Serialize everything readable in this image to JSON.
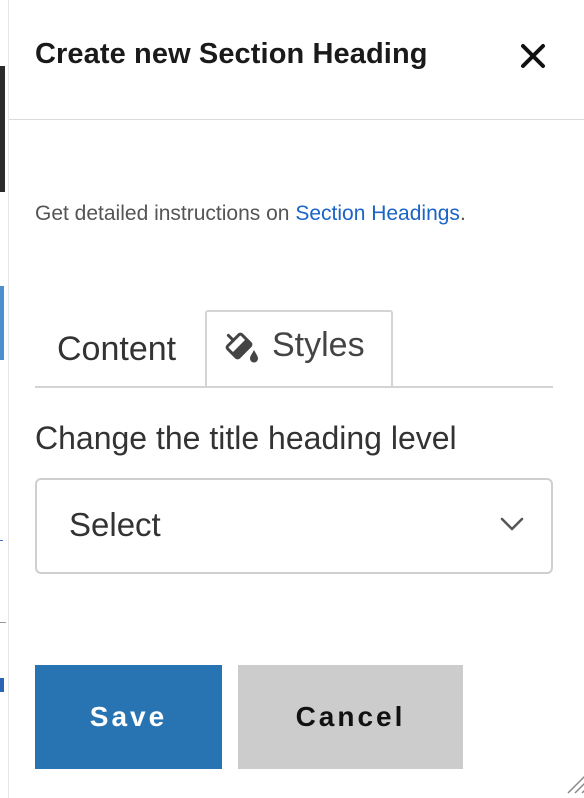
{
  "dialog": {
    "title": "Create new Section Heading",
    "close_icon": "close-icon"
  },
  "instructions": {
    "prefix": "Get detailed instructions on ",
    "link_text": "Section Headings",
    "suffix": "."
  },
  "tabs": [
    {
      "label": "Content",
      "active": false
    },
    {
      "label": "Styles",
      "icon": "paint-bucket-icon",
      "active": true
    }
  ],
  "heading_level": {
    "label": "Change the title heading level",
    "selected": "Select",
    "icon": "chevron-down-icon"
  },
  "actions": {
    "save_label": "Save",
    "cancel_label": "Cancel"
  },
  "colors": {
    "save_bg": "#2874b2",
    "cancel_bg": "#cccccc",
    "link": "#1a63c7"
  }
}
